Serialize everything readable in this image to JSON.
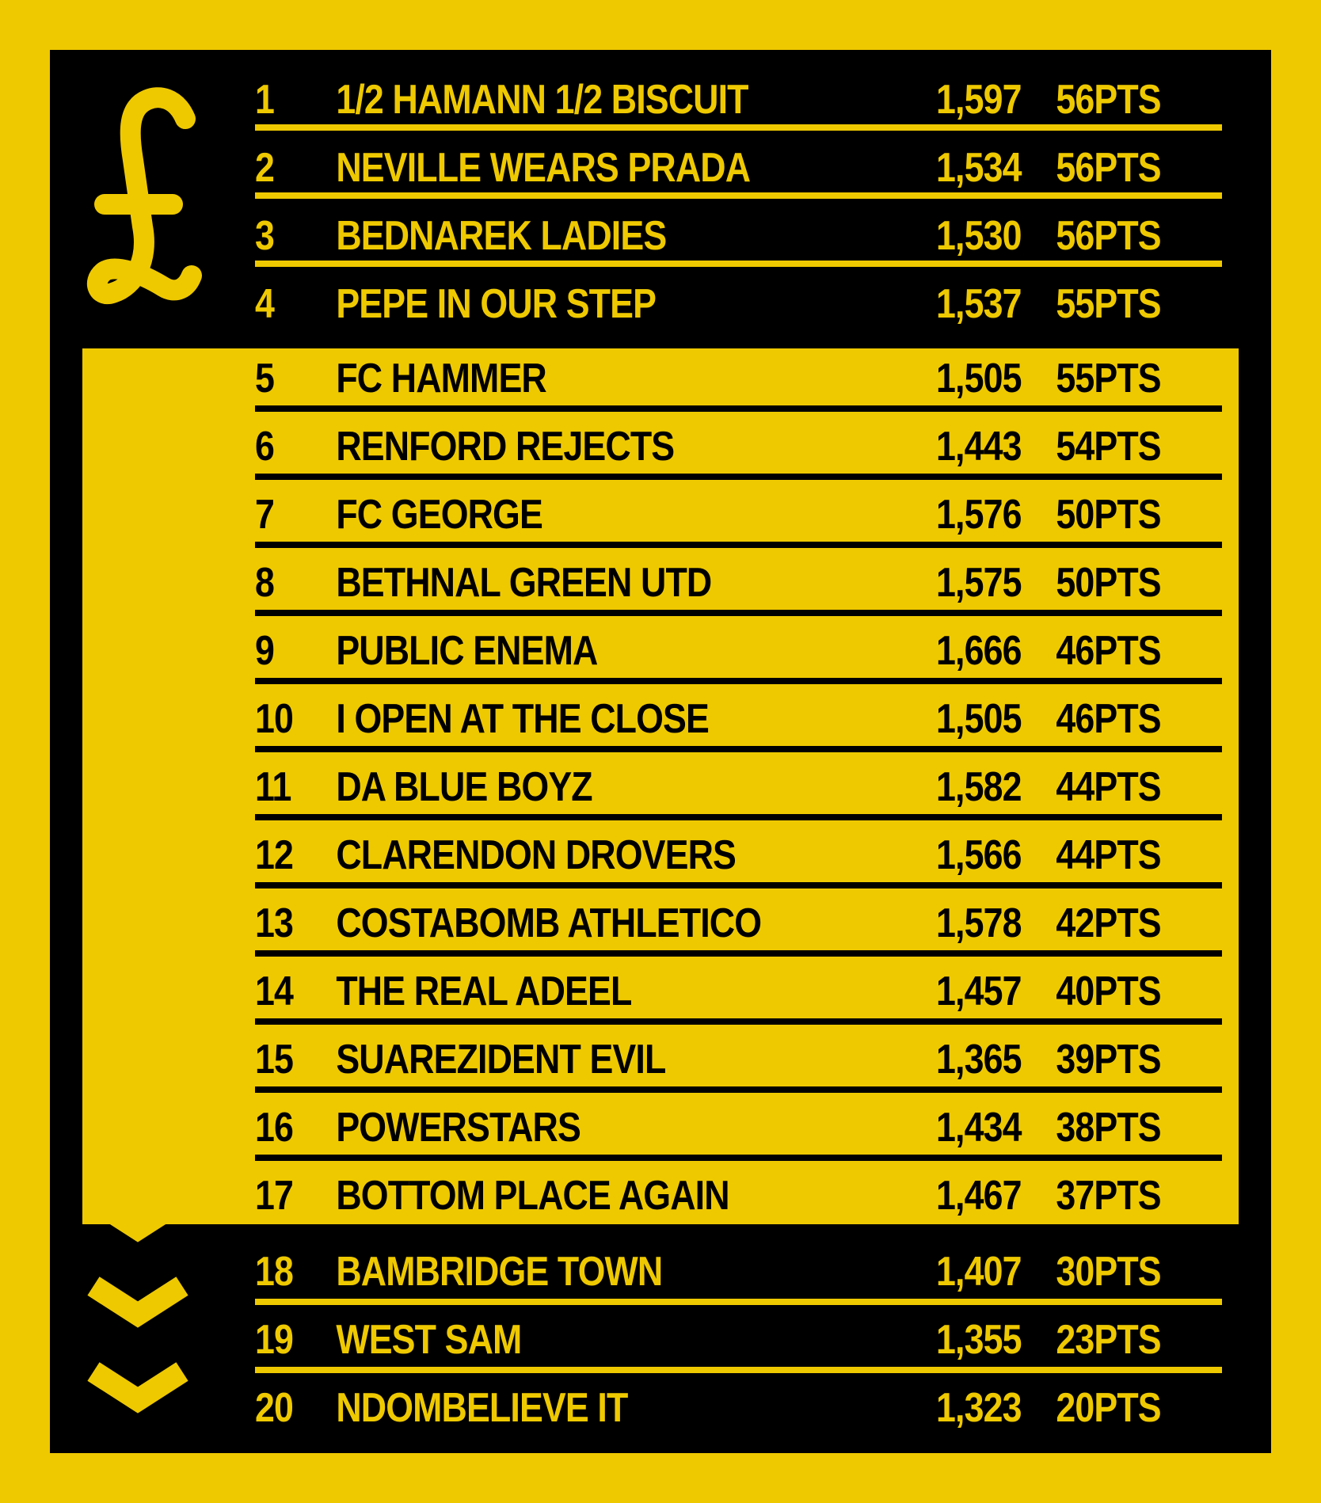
{
  "colors": {
    "accent": "#EFC900",
    "background": "#000000"
  },
  "icons": {
    "top": "pound-icon",
    "bottom": "triple-chevron-down-icon"
  },
  "table": {
    "rows": [
      {
        "rank": "1",
        "team": "1/2 HAMANN 1/2 BISCUIT",
        "score": "1,597",
        "points": "56PTS",
        "zone": "top"
      },
      {
        "rank": "2",
        "team": "NEVILLE WEARS PRADA",
        "score": "1,534",
        "points": "56PTS",
        "zone": "top"
      },
      {
        "rank": "3",
        "team": "BEDNAREK LADIES",
        "score": "1,530",
        "points": "56PTS",
        "zone": "top"
      },
      {
        "rank": "4",
        "team": "PEPE IN OUR STEP",
        "score": "1,537",
        "points": "55PTS",
        "zone": "top"
      },
      {
        "rank": "5",
        "team": "FC HAMMER",
        "score": "1,505",
        "points": "55PTS",
        "zone": "mid"
      },
      {
        "rank": "6",
        "team": "RENFORD REJECTS",
        "score": "1,443",
        "points": "54PTS",
        "zone": "mid"
      },
      {
        "rank": "7",
        "team": "FC GEORGE",
        "score": "1,576",
        "points": "50PTS",
        "zone": "mid"
      },
      {
        "rank": "8",
        "team": "BETHNAL GREEN UTD",
        "score": "1,575",
        "points": "50PTS",
        "zone": "mid"
      },
      {
        "rank": "9",
        "team": "PUBLIC ENEMA",
        "score": "1,666",
        "points": "46PTS",
        "zone": "mid"
      },
      {
        "rank": "10",
        "team": "I OPEN AT THE CLOSE",
        "score": "1,505",
        "points": "46PTS",
        "zone": "mid"
      },
      {
        "rank": "11",
        "team": "DA BLUE BOYZ",
        "score": "1,582",
        "points": "44PTS",
        "zone": "mid"
      },
      {
        "rank": "12",
        "team": "CLARENDON DROVERS",
        "score": "1,566",
        "points": "44PTS",
        "zone": "mid"
      },
      {
        "rank": "13",
        "team": "COSTABOMB ATHLETICO",
        "score": "1,578",
        "points": "42PTS",
        "zone": "mid"
      },
      {
        "rank": "14",
        "team": "THE REAL ADEEL",
        "score": "1,457",
        "points": "40PTS",
        "zone": "mid"
      },
      {
        "rank": "15",
        "team": "SUAREZIDENT EVIL",
        "score": "1,365",
        "points": "39PTS",
        "zone": "mid"
      },
      {
        "rank": "16",
        "team": "POWERSTARS",
        "score": "1,434",
        "points": "38PTS",
        "zone": "mid"
      },
      {
        "rank": "17",
        "team": "BOTTOM PLACE AGAIN",
        "score": "1,467",
        "points": "37PTS",
        "zone": "mid"
      },
      {
        "rank": "18",
        "team": "BAMBRIDGE TOWN",
        "score": "1,407",
        "points": "30PTS",
        "zone": "bottom"
      },
      {
        "rank": "19",
        "team": "WEST SAM",
        "score": "1,355",
        "points": "23PTS",
        "zone": "bottom"
      },
      {
        "rank": "20",
        "team": "NDOMBELIEVE IT",
        "score": "1,323",
        "points": "20PTS",
        "zone": "bottom"
      }
    ]
  }
}
